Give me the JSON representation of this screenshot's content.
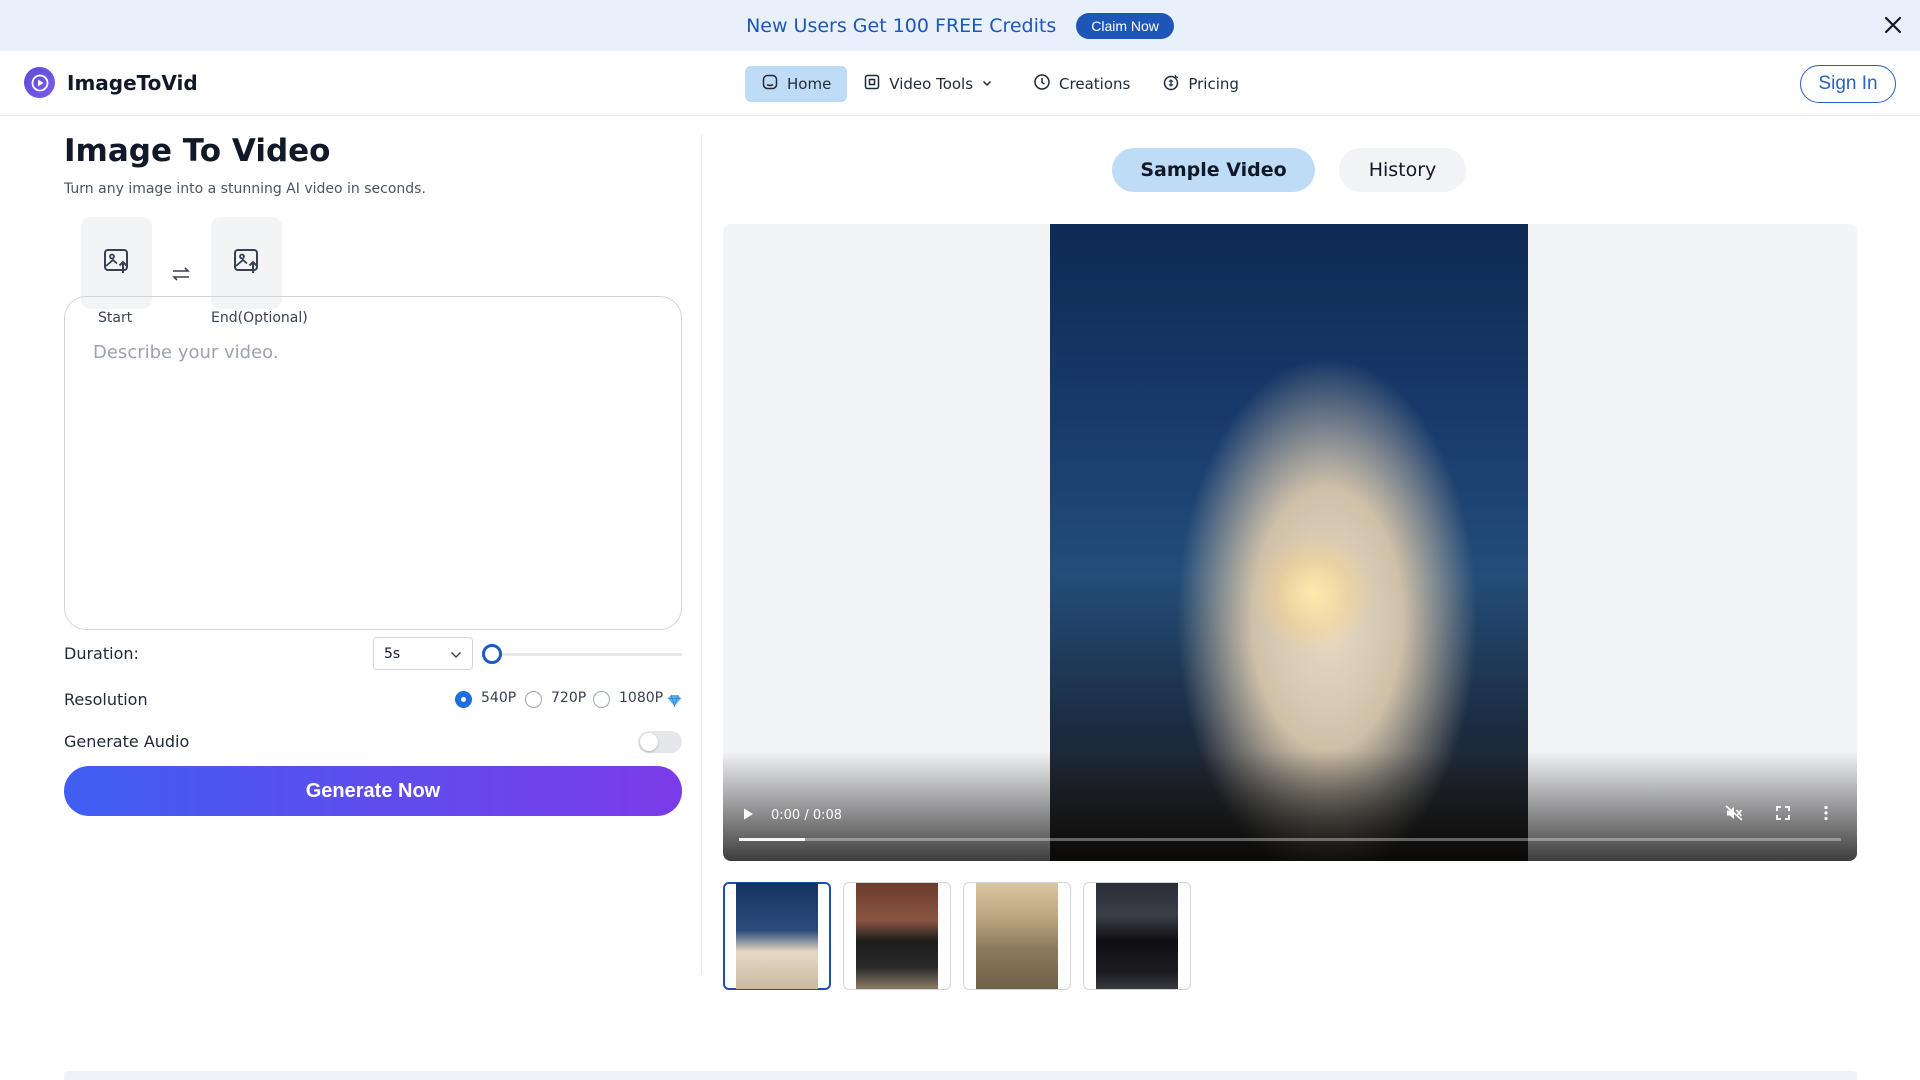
{
  "banner": {
    "text": "New Users Get 100 FREE Credits",
    "cta": "Claim Now"
  },
  "header": {
    "brand": "ImageToVid",
    "nav": [
      {
        "label": "Home",
        "icon": "home-icon",
        "active": true
      },
      {
        "label": "Video Tools",
        "icon": "video-tools-icon"
      },
      {
        "label": "Creations",
        "icon": "clock-icon"
      },
      {
        "label": "Pricing",
        "icon": "pricing-icon"
      }
    ],
    "signin": "Sign In"
  },
  "left": {
    "title": "Image To Video",
    "subtitle": "Turn any image into a stunning AI video in seconds.",
    "uploads": {
      "start": "Start",
      "end": "End(Optional)"
    },
    "prompt_placeholder": "Describe your video.",
    "duration_label": "Duration:",
    "duration_value": "5s",
    "resolution_label": "Resolution",
    "resolutions": [
      {
        "label": "540P",
        "selected": true
      },
      {
        "label": "720P",
        "selected": false
      },
      {
        "label": "1080P",
        "selected": false,
        "premium": true
      }
    ],
    "audio_label": "Generate Audio",
    "audio_on": false,
    "generate": "Generate Now"
  },
  "right": {
    "tabs": [
      {
        "label": "Sample Video",
        "active": true
      },
      {
        "label": "History",
        "active": false
      }
    ],
    "video": {
      "time": "0:00 / 0:08",
      "progress": 0.06
    },
    "thumbnails": [
      "couple-beach",
      "woman-street",
      "woman-cliff",
      "woman-night-street"
    ]
  },
  "colors": {
    "accent": "#1d5bc4",
    "gradient_start": "#3f5ff2",
    "gradient_end": "#7c3be8",
    "banner_bg": "#e8f1fb"
  }
}
